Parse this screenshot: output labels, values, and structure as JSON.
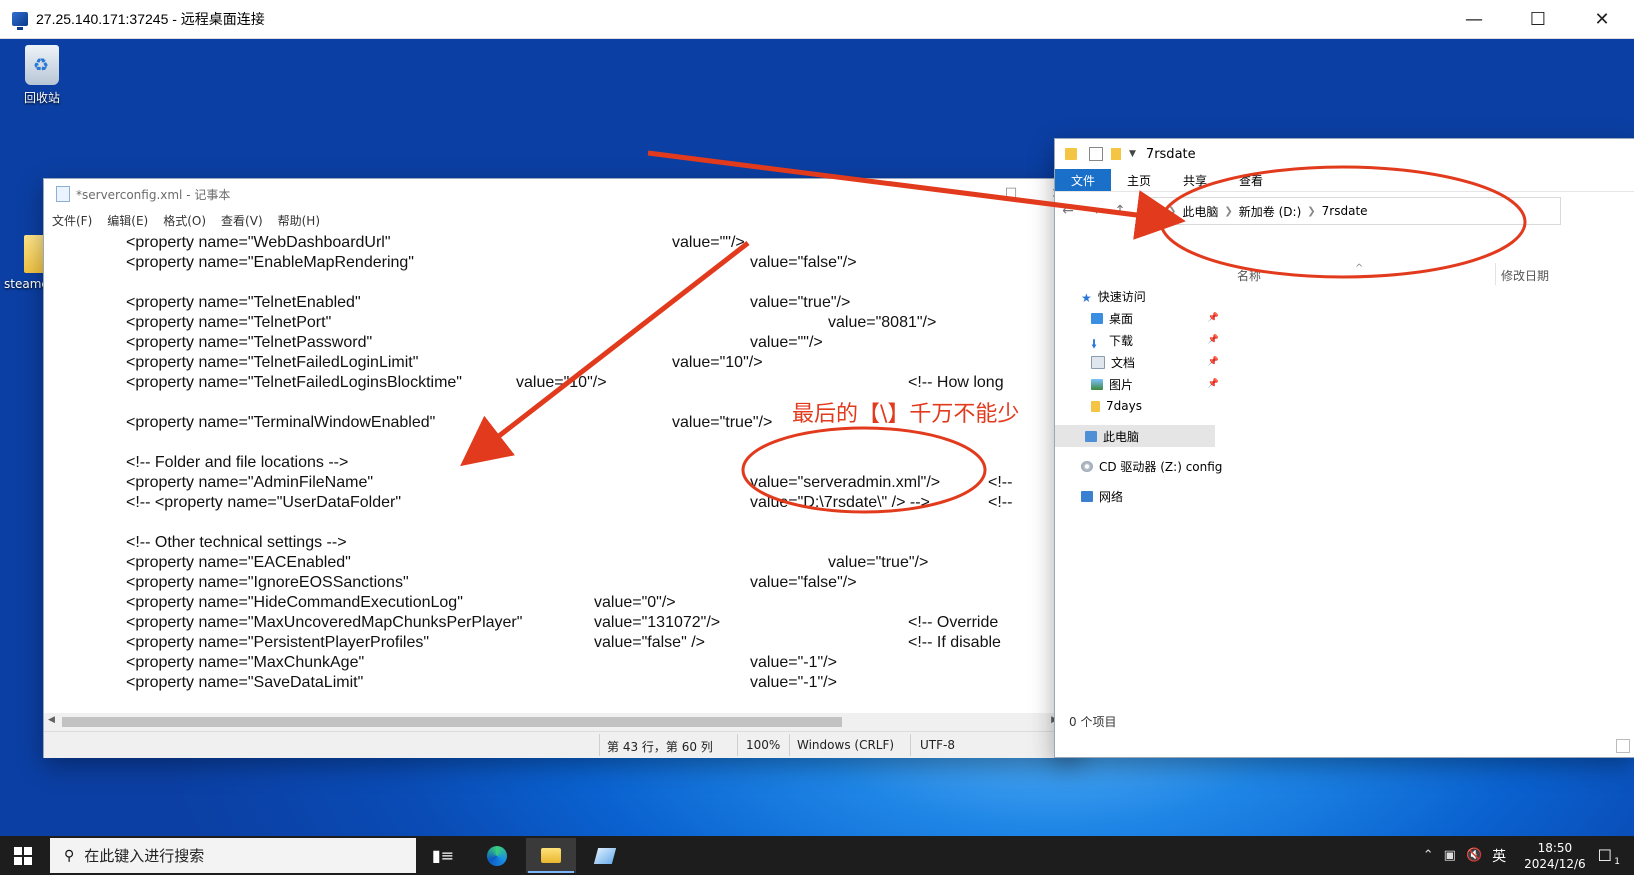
{
  "rdp": {
    "title": "27.25.140.171:37245 - 远程桌面连接"
  },
  "desktop": {
    "recycle_bin": "回收站",
    "steam_folder": "steamc"
  },
  "notepad": {
    "title": "*serverconfig.xml - 记事本",
    "menu": [
      "文件(F)",
      "编辑(E)",
      "格式(O)",
      "查看(V)",
      "帮助(H)"
    ],
    "lines": [
      {
        "a": "<property name=\"WebDashboardUrl\"",
        "b": "value=\"\"/>",
        "c": ""
      },
      {
        "a": "<property name=\"EnableMapRendering\"",
        "b": "value=\"false\"/>",
        "c": ""
      },
      {
        "a": "",
        "b": "",
        "c": ""
      },
      {
        "a": "<property name=\"TelnetEnabled\"",
        "b": "value=\"true\"/>",
        "c": ""
      },
      {
        "a": "<property name=\"TelnetPort\"",
        "b": "value=\"8081\"/>",
        "c": ""
      },
      {
        "a": "<property name=\"TelnetPassword\"",
        "b": "value=\"\"/>",
        "c": ""
      },
      {
        "a": "<property name=\"TelnetFailedLoginLimit\"",
        "b": "value=\"10\"/>",
        "c": ""
      },
      {
        "a": "<property name=\"TelnetFailedLoginsBlocktime\"",
        "b": "value=\"10\"/>",
        "c": "<!-- How long"
      },
      {
        "a": "",
        "b": "",
        "c": ""
      },
      {
        "a": "<property name=\"TerminalWindowEnabled\"",
        "b": "value=\"true\"/>",
        "c": ""
      },
      {
        "a": "",
        "b": "",
        "c": ""
      },
      {
        "a": "<!-- Folder and file locations -->",
        "b": "",
        "c": ""
      },
      {
        "a": "<property name=\"AdminFileName\"",
        "b": "value=\"serveradmin.xml\"/>",
        "c": "<!--"
      },
      {
        "a": "<!-- <property name=\"UserDataFolder\"",
        "b": "value=\"D:\\7rsdate\\\" /> -->",
        "c": "<!--"
      },
      {
        "a": "",
        "b": "",
        "c": ""
      },
      {
        "a": "<!-- Other technical settings -->",
        "b": "",
        "c": ""
      },
      {
        "a": "<property name=\"EACEnabled\"",
        "b": "value=\"true\"/>",
        "c": ""
      },
      {
        "a": "<property name=\"IgnoreEOSSanctions\"",
        "b": "value=\"false\"/>",
        "c": ""
      },
      {
        "a": "<property name=\"HideCommandExecutionLog\"",
        "b": "value=\"0\"/>",
        "c": ""
      },
      {
        "a": "<property name=\"MaxUncoveredMapChunksPerPlayer\"",
        "b": "value=\"131072\"/>",
        "c": "<!-- Override"
      },
      {
        "a": "<property name=\"PersistentPlayerProfiles\"",
        "b": "value=\"false\" />",
        "c": "<!-- If disable"
      },
      {
        "a": "<property name=\"MaxChunkAge\"",
        "b": "value=\"-1\"/>",
        "c": ""
      },
      {
        "a": "<property name=\"SaveDataLimit\"",
        "b": "value=\"-1\"/>",
        "c": ""
      }
    ],
    "status": {
      "position": "第 43 行，第 60 列",
      "zoom": "100%",
      "eol": "Windows (CRLF)",
      "encoding": "UTF-8"
    }
  },
  "explorer": {
    "title": "7rsdate",
    "ribbon": [
      "文件",
      "主页",
      "共享",
      "查看"
    ],
    "breadcrumb": [
      "此电脑",
      "新加卷 (D:)",
      "7rsdate"
    ],
    "columns": {
      "name": "名称",
      "modified": "修改日期"
    },
    "quick_access": "快速访问",
    "nav": [
      {
        "label": "桌面",
        "pinned": true
      },
      {
        "label": "下载",
        "pinned": true
      },
      {
        "label": "文档",
        "pinned": true
      },
      {
        "label": "图片",
        "pinned": true
      },
      {
        "label": "7days",
        "pinned": false
      }
    ],
    "this_pc": "此电脑",
    "cd_drive": "CD 驱动器 (Z:) config",
    "network": "网络",
    "item_count": "0 个项目"
  },
  "annotation": {
    "text": "最后的【\\】千万不能少",
    "color": "#e23a1d"
  },
  "taskbar": {
    "search_placeholder": "在此键入进行搜索",
    "ime": "英",
    "time": "18:50",
    "date": "2024/12/6",
    "notification_count": "1"
  }
}
